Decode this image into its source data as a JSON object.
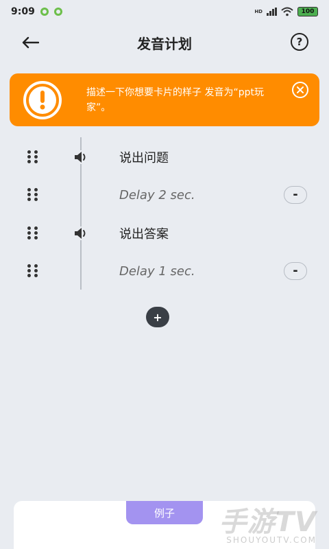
{
  "status_bar": {
    "time": "9:09",
    "network_label": "HD",
    "battery": "100"
  },
  "header": {
    "title": "发音计划",
    "back_icon": "arrow-left-icon",
    "help_label": "?"
  },
  "banner": {
    "icon": "alert-icon",
    "text": "描述一下你想要卡片的样子 发音为“ppt玩家”。",
    "close_icon": "close-icon",
    "color": "#ff8c00"
  },
  "timeline": {
    "items": [
      {
        "type": "speech",
        "label": "说出问题",
        "icon": "speaker-icon"
      },
      {
        "type": "delay",
        "label": "Delay 2 sec.",
        "remove_label": "-"
      },
      {
        "type": "speech",
        "label": "说出答案",
        "icon": "speaker-icon"
      },
      {
        "type": "delay",
        "label": "Delay 1 sec.",
        "remove_label": "-"
      }
    ],
    "add_label": "+"
  },
  "bottom": {
    "example_tab": "例子",
    "tab_color": "#a393f0"
  },
  "watermark": {
    "text": "手游TV",
    "sub": "SHOUYOUTV.COM"
  }
}
